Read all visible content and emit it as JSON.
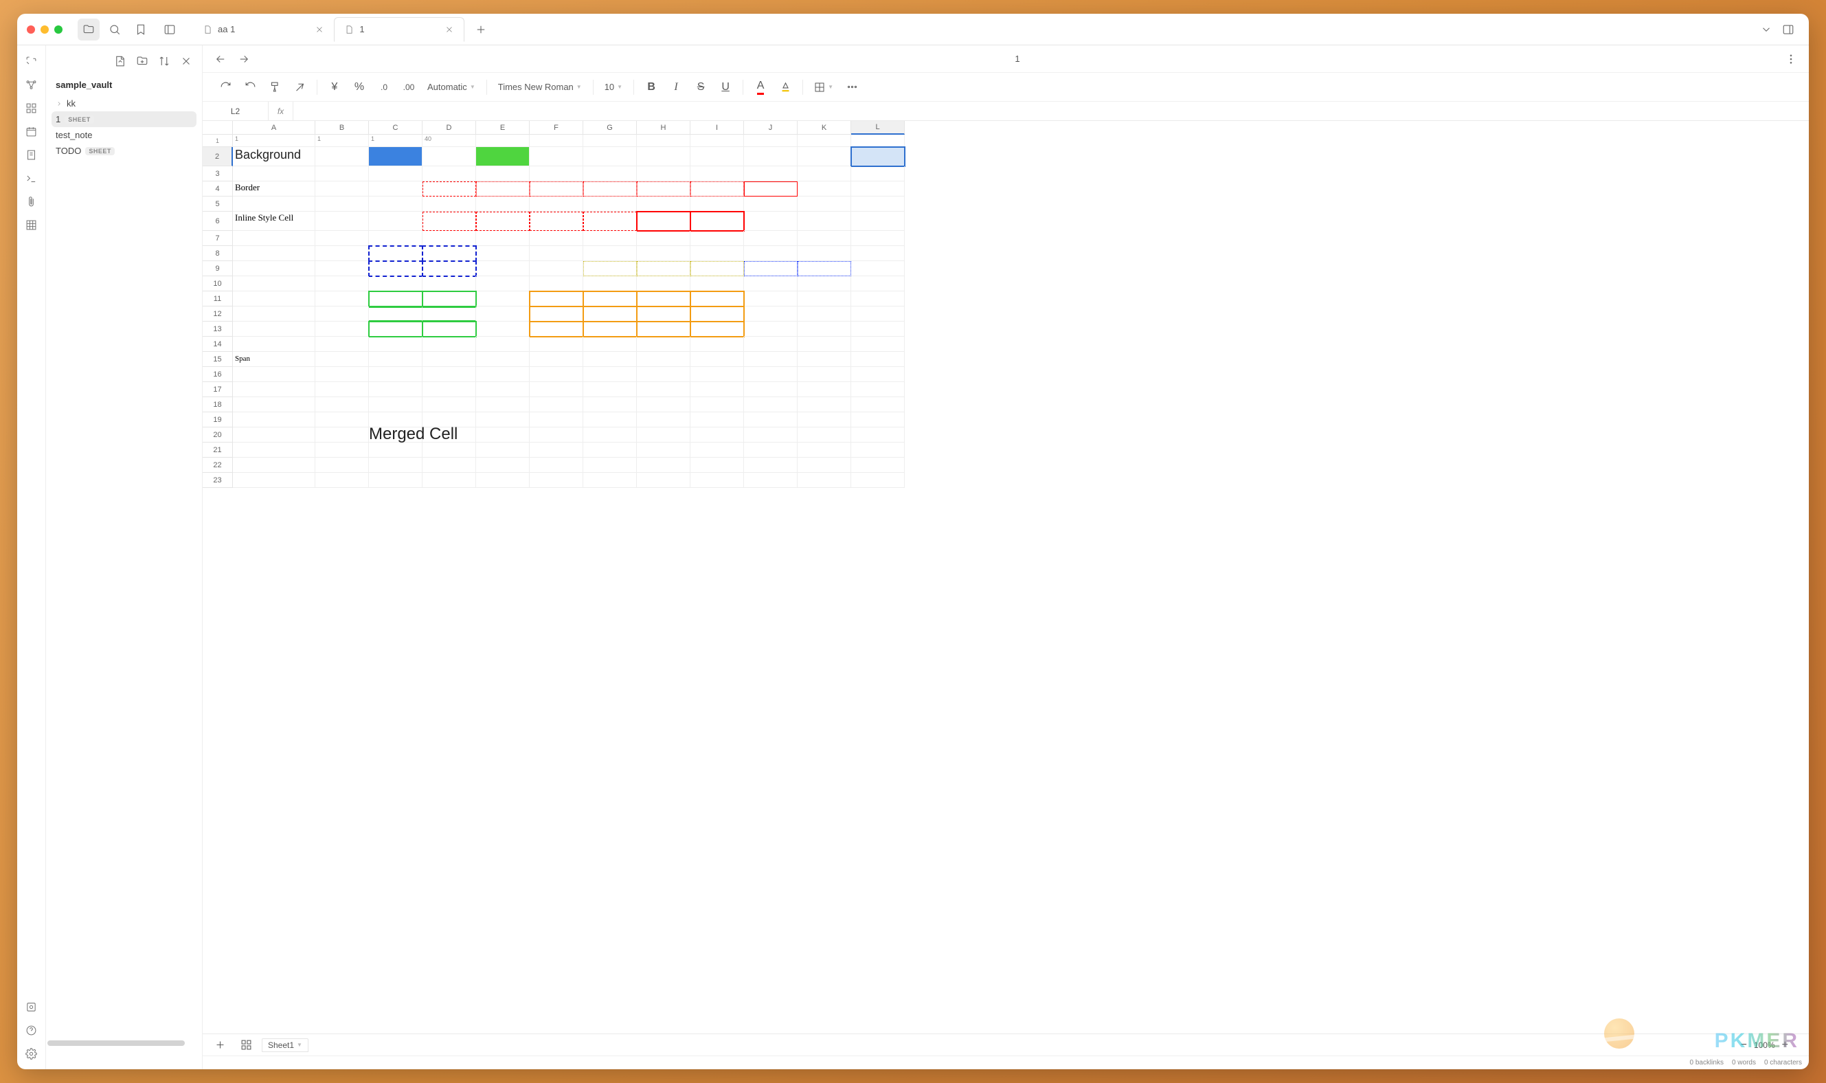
{
  "titlebar": {
    "tabs": [
      {
        "label": "aa 1",
        "active": false
      },
      {
        "label": "1",
        "active": true
      }
    ]
  },
  "sidebar": {
    "vault": "sample_vault",
    "items": [
      {
        "label": "kk",
        "badge": null,
        "folder": true
      },
      {
        "label": "1",
        "badge": "SHEET",
        "selected": true
      },
      {
        "label": "test_note",
        "badge": null
      },
      {
        "label": "TODO",
        "badge": "SHEET"
      }
    ]
  },
  "tab_header": {
    "title": "1"
  },
  "toolbar": {
    "number_format": "Automatic",
    "font_family": "Times New Roman",
    "font_size": "10"
  },
  "formula_bar": {
    "cell_ref": "L2",
    "fx": "fx",
    "value": ""
  },
  "spreadsheet": {
    "columns": [
      "A",
      "B",
      "C",
      "D",
      "E",
      "F",
      "G",
      "H",
      "I",
      "J",
      "K",
      "L"
    ],
    "selected_column": "L",
    "selected_row": 2,
    "row_count": 23,
    "cells": {
      "r1": {
        "A": "1",
        "B": "1",
        "C": "1",
        "D": "40"
      },
      "r2": {
        "A": "Background"
      },
      "r4": {
        "A": "Border"
      },
      "r6": {
        "A": "Inline Style Cell"
      },
      "r15": {
        "A": "Span"
      },
      "merged": "Merged Cell"
    }
  },
  "sheet_tabs": {
    "sheet": "Sheet1"
  },
  "zoom": {
    "value": "100%"
  },
  "status": {
    "backlinks": "0 backlinks",
    "words": "0 words",
    "characters": "0 characters"
  },
  "watermark": "PKMER"
}
